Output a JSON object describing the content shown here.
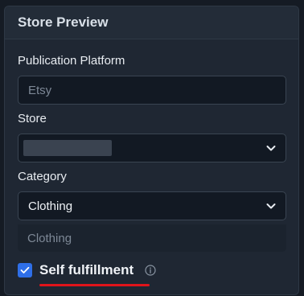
{
  "panel": {
    "title": "Store Preview"
  },
  "publication_platform": {
    "label": "Publication Platform",
    "value": "Etsy"
  },
  "store": {
    "label": "Store",
    "value": ""
  },
  "category": {
    "label": "Category",
    "value": "Clothing",
    "options": [
      "Clothing"
    ]
  },
  "self_fulfillment": {
    "label": "Self fulfillment",
    "checked": true
  },
  "icons": {
    "dropdown": "chevron-down-icon",
    "info": "info-icon",
    "check": "check-icon"
  },
  "colors": {
    "accent": "#2f6fe8",
    "highlight_underline": "#e0141a"
  }
}
